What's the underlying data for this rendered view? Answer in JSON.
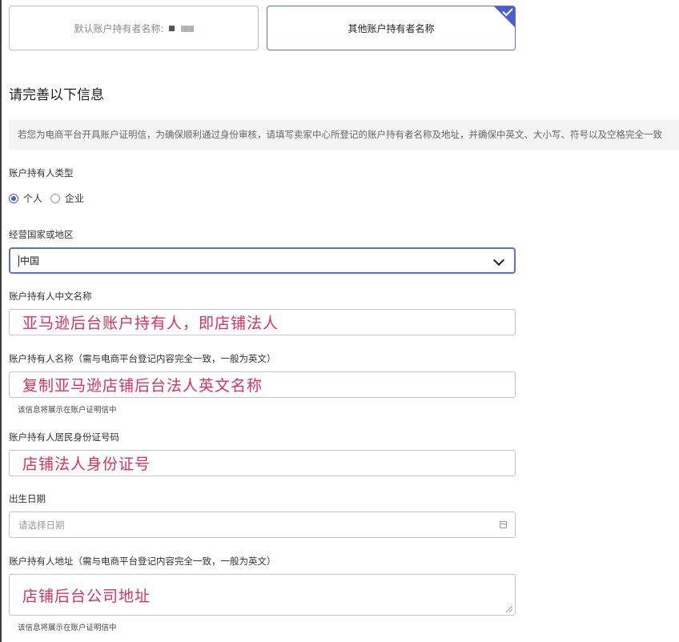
{
  "cards": {
    "default_label": "默认账户持有者名称:",
    "other_label": "其他账户持有者名称"
  },
  "section": {
    "title": "请完善以下信息",
    "notice": "若您为电商平台开具账户证明信，为确保顺利通过身份审核，请填写卖家中心所登记的账户持有者名称及地址，并确保中英文、大小写、符号以及空格完全一致"
  },
  "holder_type": {
    "label": "账户持有人类型",
    "options": [
      "个人",
      "企业"
    ],
    "selected": "个人"
  },
  "country": {
    "label": "经营国家或地区",
    "value": "中国"
  },
  "cn_name": {
    "label": "账户持有人中文名称",
    "value": "亚马逊后台账户持有人，即店铺法人"
  },
  "name": {
    "label": "账户持有人名称（需与电商平台登记内容完全一致，一般为英文）",
    "value": "复制亚马逊店铺后台法人英文名称",
    "hint": "该信息将展示在账户证明信中"
  },
  "id_number": {
    "label": "账户持有人居民身份证号码",
    "value": "店铺法人身份证号"
  },
  "birth_date": {
    "label": "出生日期",
    "placeholder": "请选择日期"
  },
  "address": {
    "label": "账户持有人地址（需与电商平台登记内容完全一致，一般为英文）",
    "value": "店铺后台公司地址",
    "hint": "该信息将展示在账户证明信中"
  },
  "colors": {
    "accent": "#4a5ed0",
    "annotation": "#e0305a"
  },
  "icons": {
    "select": "chevron-down-icon",
    "date": "calendar-icon",
    "selected_card": "checkmark-icon"
  }
}
